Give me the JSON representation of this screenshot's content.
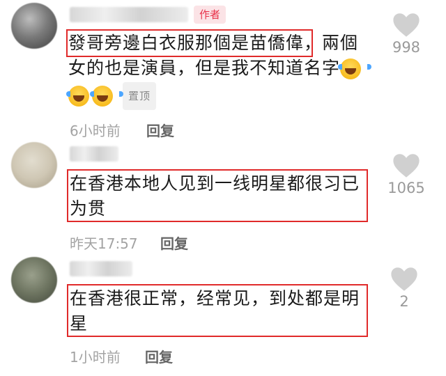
{
  "comments": [
    {
      "author_badge": "作者",
      "text_lines": [
        "發哥旁邊白衣服那個是苗僑偉，兩個",
        "女的也是演員，但是我不知道名字"
      ],
      "pinned_label": "置顶",
      "time": "6小时前",
      "reply_label": "回复",
      "likes": "998"
    },
    {
      "text_lines": [
        "在香港本地人见到一线明星都很习已",
        "为贯"
      ],
      "time": "昨天17:57",
      "reply_label": "回复",
      "likes": "1065"
    },
    {
      "text_lines": [
        "在香港很正常，经常见，到处都是明",
        "星"
      ],
      "time": "1小时前",
      "reply_label": "回复",
      "likes": "2"
    }
  ],
  "colors": {
    "highlight_box": "#e02a2a",
    "author_badge": "#e8334a",
    "like_icon": "#d0d0d0"
  },
  "icons": {
    "like": "heart-icon",
    "emoji": "laughing-tears-emoji"
  }
}
